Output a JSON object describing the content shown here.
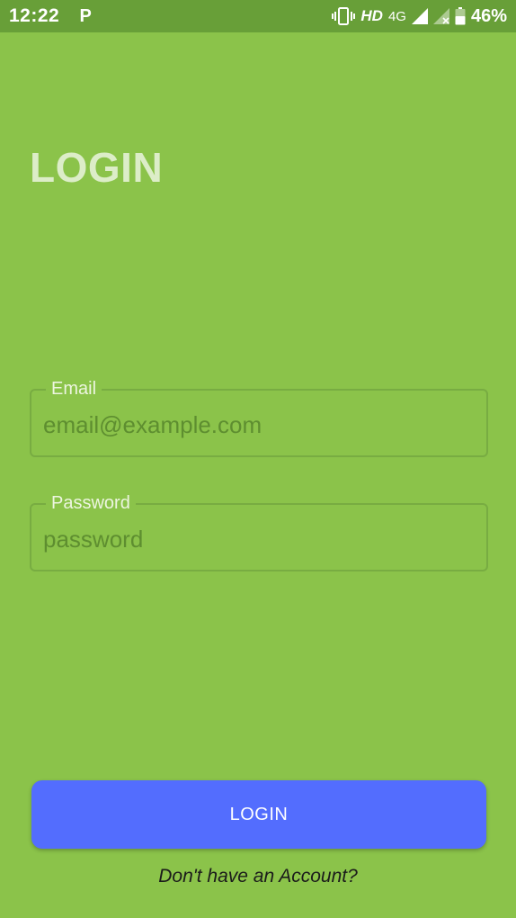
{
  "status_bar": {
    "time": "12:22",
    "notification_letter": "P",
    "hd_label": "HD",
    "network_label": "4G",
    "battery_percent": "46%"
  },
  "page": {
    "title": "LOGIN",
    "background_color": "#8bc34a"
  },
  "form": {
    "email": {
      "label": "Email",
      "placeholder": "email@example.com",
      "value": ""
    },
    "password": {
      "label": "Password",
      "placeholder": "password",
      "value": ""
    },
    "submit_label": "LOGIN",
    "submit_color": "#536dfe"
  },
  "footer": {
    "signup_link": "Don't have an Account?"
  }
}
